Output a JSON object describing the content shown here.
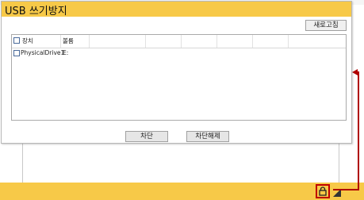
{
  "dialog": {
    "title": "USB 쓰기방지",
    "refresh_label": "새로고침",
    "columns": [
      {
        "label": "장치"
      },
      {
        "label": "볼륨"
      }
    ],
    "rows": [
      {
        "checked": false,
        "device": "PhysicalDrive1",
        "volume": "E:"
      }
    ],
    "block_label": "차단",
    "unblock_label": "차단해제"
  },
  "taskbar": {
    "tray_icon": "lock-icon",
    "accent_color": "#f7c948",
    "highlight_color": "#c00000"
  }
}
